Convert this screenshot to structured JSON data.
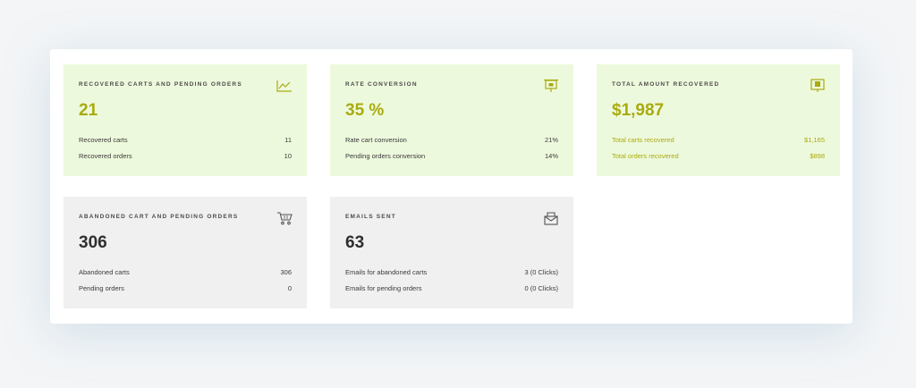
{
  "cards": [
    {
      "title": "RECOVERED CARTS AND PENDING ORDERS",
      "icon": "line-chart-icon",
      "value": "21",
      "rows": [
        {
          "label": "Recovered carts",
          "value": "11"
        },
        {
          "label": "Recovered orders",
          "value": "10"
        }
      ]
    },
    {
      "title": "RATE CONVERSION",
      "icon": "presentation-board-icon",
      "value": "35 %",
      "rows": [
        {
          "label": "Rate cart conversion",
          "value": "21%"
        },
        {
          "label": "Pending orders conversion",
          "value": "14%"
        }
      ]
    },
    {
      "title": "TOTAL AMOUNT RECOVERED",
      "icon": "money-bill-icon",
      "value": "$1,987",
      "rows": [
        {
          "label": "Total carts recovered",
          "value": "$1,165"
        },
        {
          "label": "Total orders recovered",
          "value": "$898"
        }
      ]
    },
    {
      "title": "ABANDONED CART AND PENDING ORDERS",
      "icon": "shopping-cart-icon",
      "value": "306",
      "rows": [
        {
          "label": "Abandoned carts",
          "value": "306"
        },
        {
          "label": "Pending orders",
          "value": "0"
        }
      ]
    },
    {
      "title": "EMAILS SENT",
      "icon": "envelope-icon",
      "value": "63",
      "rows": [
        {
          "label": "Emails for abandoned carts",
          "value": "3 (0 Clicks)"
        },
        {
          "label": "Emails for pending orders",
          "value": "0 (0 Clicks)"
        }
      ]
    }
  ],
  "colors": {
    "accent": "#a9ab0f",
    "green_card": "#edf9dc",
    "grey_card": "#f0f0f0"
  }
}
